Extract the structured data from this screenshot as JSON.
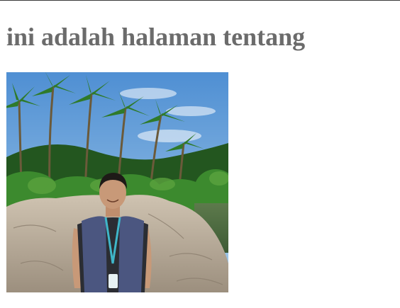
{
  "page": {
    "heading": "ini adalah halaman tentang"
  },
  "photo": {
    "subject": "person-portrait",
    "sky_color": "#6fa7dc",
    "foliage_color": "#2f6a26",
    "rock_color": "#b9ab98",
    "vest_color": "#4b5680"
  }
}
